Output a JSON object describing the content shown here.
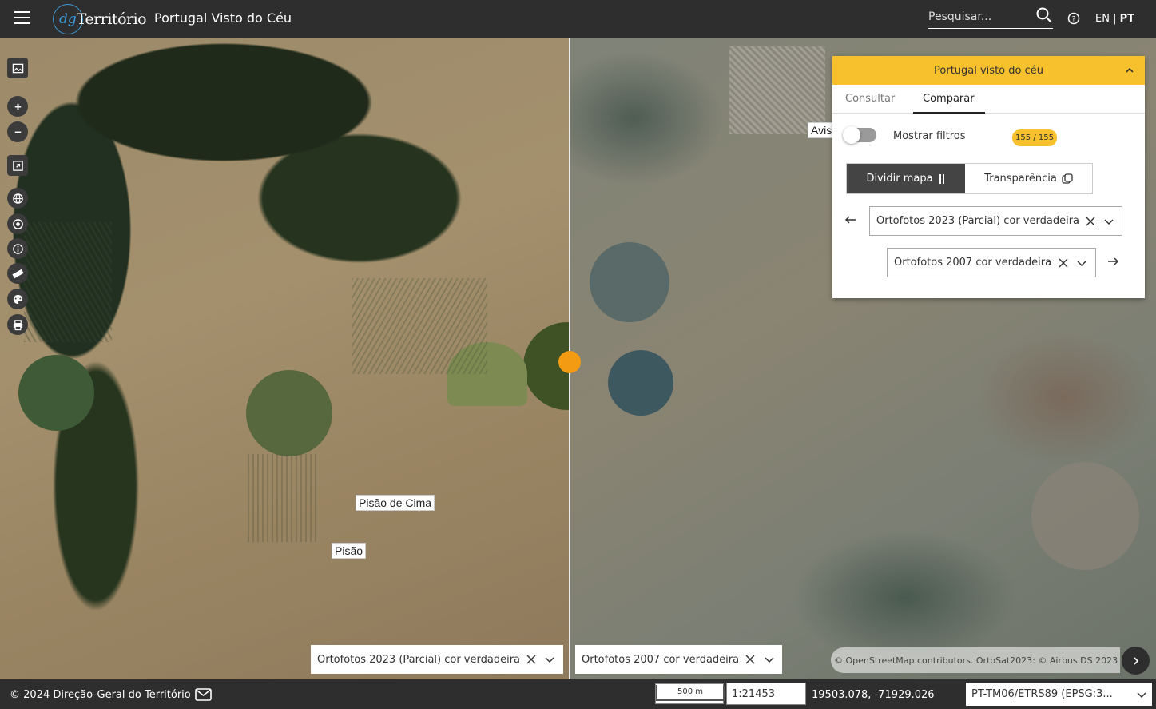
{
  "header": {
    "logo_dg": "dg",
    "logo_name": "Território",
    "app_title": "Portugal Visto do Céu",
    "search_placeholder": "Pesquisar...",
    "lang_en": "EN",
    "lang_sep": "|",
    "lang_pt": "PT"
  },
  "map": {
    "left_labels": [
      "Pisão de Cima",
      "Pisão"
    ],
    "right_labels": [
      "Avis"
    ]
  },
  "panel": {
    "title": "Portugal visto do céu",
    "tabs": [
      "Consultar",
      "Comparar"
    ],
    "active_tab": "Comparar",
    "show_filters_label": "Mostrar filtros",
    "show_filters_on": false,
    "count_badge": "155 / 155",
    "split_map_label": "Dividir mapa",
    "transparency_label": "Transparência",
    "left_layer": "Ortofotos 2023 (Parcial) cor verdadeira",
    "right_layer": "Ortofotos 2007 cor verdadeira"
  },
  "bottom_pickers": {
    "left": "Ortofotos 2023 (Parcial) cor verdadeira",
    "right": "Ortofotos 2007 cor verdadeira"
  },
  "attribution": "© OpenStreetMap contributors. OrtoSat2023: © Airbus DS 2023",
  "footer": {
    "copyright": "© 2024 Direção-Geral do Território",
    "scale_bar_label": "500 m",
    "scale_value": "1:21453",
    "coordinates": "19503.078, -71929.026",
    "crs": "PT-TM06/ETRS89 (EPSG:3..."
  },
  "colors": {
    "accent": "#f7c12d",
    "split_handle": "#f39b12",
    "header_bg": "#2e2e2e"
  },
  "icons": [
    "menu-icon",
    "search-icon",
    "help-icon",
    "image-icon",
    "zoom-in-icon",
    "zoom-out-icon",
    "expand-icon",
    "globe-icon",
    "target-icon",
    "info-icon",
    "ruler-icon",
    "palette-icon",
    "print-icon",
    "chevron-up-icon",
    "arrow-left-icon",
    "arrow-right-icon",
    "close-icon",
    "chevron-down-icon",
    "mail-icon",
    "chevron-right-icon"
  ]
}
